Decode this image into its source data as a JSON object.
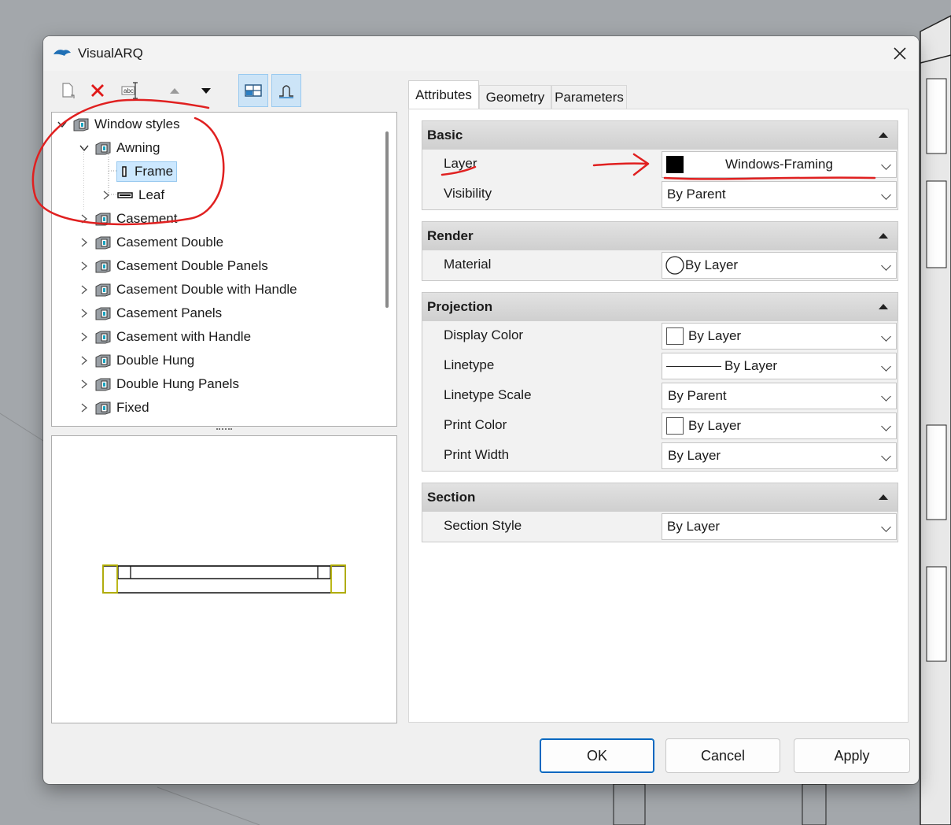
{
  "window": {
    "title": "VisualARQ",
    "app_icon": "visualarq-logo-icon",
    "close_icon": "close-icon"
  },
  "toolbar": {
    "buttons": [
      "new-document-icon",
      "delete-icon",
      "rename-icon",
      "move-up-icon",
      "move-down-icon",
      "split-view-icon",
      "profile-view-icon"
    ]
  },
  "tree": {
    "root": "Window styles",
    "awning": "Awning",
    "frame": "Frame",
    "leaf": "Leaf",
    "items": [
      "Casement",
      "Casement Double",
      "Casement Double Panels",
      "Casement Double with Handle",
      "Casement Panels",
      "Casement with Handle",
      "Double Hung",
      "Double Hung Panels",
      "Fixed"
    ]
  },
  "tabs": [
    "Attributes",
    "Geometry",
    "Parameters"
  ],
  "sections": {
    "basic": {
      "title": "Basic",
      "rows": [
        {
          "label": "Layer",
          "value": "Windows-Framing"
        },
        {
          "label": "Visibility",
          "value": "By Parent"
        }
      ]
    },
    "render": {
      "title": "Render",
      "rows": [
        {
          "label": "Material",
          "value": "By Layer"
        }
      ]
    },
    "projection": {
      "title": "Projection",
      "rows": [
        {
          "label": "Display Color",
          "value": "By Layer"
        },
        {
          "label": "Linetype",
          "value": "By Layer"
        },
        {
          "label": "Linetype Scale",
          "value": "By Parent"
        },
        {
          "label": "Print Color",
          "value": "By Layer"
        },
        {
          "label": "Print Width",
          "value": "By Layer"
        }
      ]
    },
    "section": {
      "title": "Section",
      "rows": [
        {
          "label": "Section Style",
          "value": "By Layer"
        }
      ]
    }
  },
  "buttons": {
    "ok": "OK",
    "cancel": "Cancel",
    "apply": "Apply"
  },
  "colors": {
    "annotation": "#e02020",
    "selection": "#cce8ff",
    "layer_swatch": "#000000"
  }
}
